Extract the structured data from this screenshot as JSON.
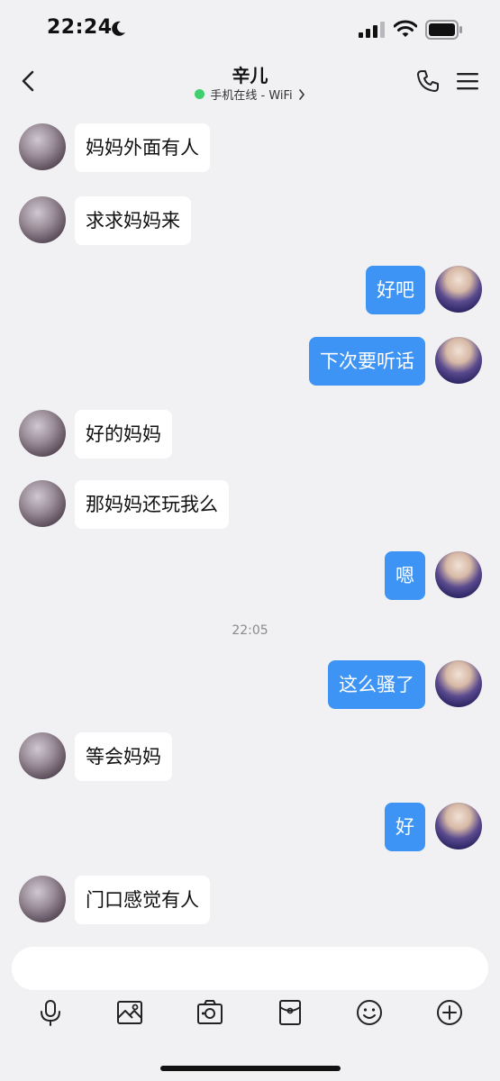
{
  "status_bar": {
    "time": "22:24"
  },
  "nav": {
    "contact_name": "辛儿",
    "status_text": "手机在线 - WiFi"
  },
  "messages": [
    {
      "side": "in",
      "text": "妈妈外面有人"
    },
    {
      "side": "in",
      "text": "求求妈妈来"
    },
    {
      "side": "out",
      "text": "好吧"
    },
    {
      "side": "out",
      "text": "下次要听话"
    },
    {
      "side": "in",
      "text": "好的妈妈"
    },
    {
      "side": "in",
      "text": "那妈妈还玩我么"
    },
    {
      "side": "out",
      "text": "嗯"
    },
    {
      "side": "out",
      "text": "这么骚了"
    },
    {
      "side": "in",
      "text": "等会妈妈"
    },
    {
      "side": "out",
      "text": "好"
    },
    {
      "side": "in",
      "text": "门口感觉有人"
    }
  ],
  "timestamp": "22:05",
  "input": {
    "value": "",
    "placeholder": ""
  },
  "toolbar": {
    "icons": [
      "microphone-icon",
      "image-icon",
      "camera-icon",
      "red-packet-icon",
      "emoji-icon",
      "plus-icon"
    ]
  },
  "colors": {
    "background": "#f1f1f3",
    "outgoing_bubble": "#3e94f4",
    "incoming_bubble": "#ffffff",
    "online_dot": "#3fcf6e"
  }
}
